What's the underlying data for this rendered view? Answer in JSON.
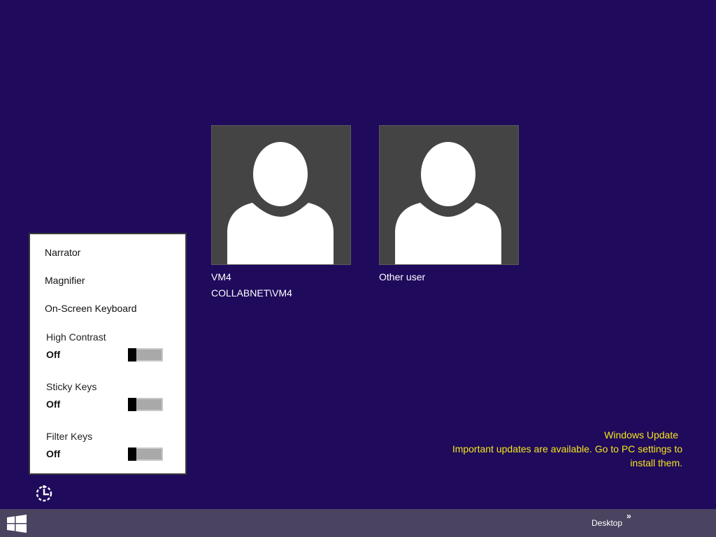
{
  "users": [
    {
      "name": "VM4",
      "domain": "COLLABNET\\VM4"
    },
    {
      "name": "Other user",
      "domain": ""
    }
  ],
  "ease_of_access": {
    "menu_items": [
      "Narrator",
      "Magnifier",
      "On-Screen Keyboard"
    ],
    "toggles": [
      {
        "label": "High Contrast",
        "state": "Off",
        "level": 0
      },
      {
        "label": "Sticky Keys",
        "state": "Off",
        "level": 0
      },
      {
        "label": "Filter Keys",
        "state": "Off",
        "level": 0
      }
    ],
    "icon": "ease-of-access-icon"
  },
  "notification": {
    "title": "Windows Update",
    "line1": "Important updates are available. Go to PC settings to",
    "line2": "install them."
  },
  "taskbar": {
    "start_icon": "windows-logo-icon",
    "desktop_label": "Desktop",
    "desktop_chevron": "»"
  },
  "colors": {
    "background": "#1f0a5c",
    "tile": "#444444",
    "notice_text": "#f5e61c",
    "taskbar": "#4b4460"
  }
}
